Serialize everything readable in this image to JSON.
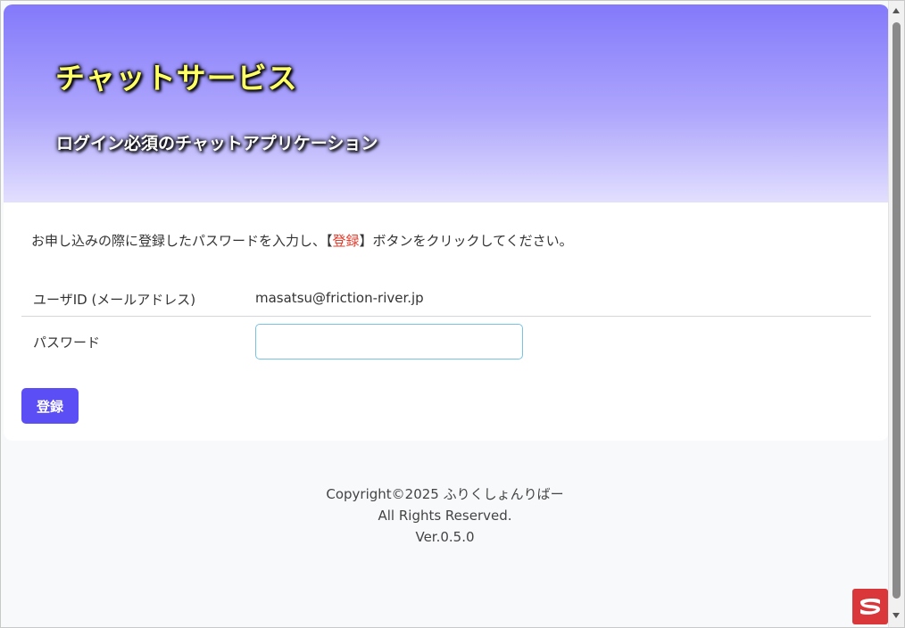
{
  "header": {
    "title": "チャットサービス",
    "subtitle": "ログイン必須のチャットアプリケーション"
  },
  "instruction": {
    "before": "お申し込みの際に登録したパスワードを入力し、【",
    "highlight": "登録",
    "after": "】ボタンをクリックしてください。"
  },
  "form": {
    "userid_label": "ユーザID (メールアドレス)",
    "userid_value": "masatsu@friction-river.jp",
    "password_label": "パスワード",
    "password_value": "",
    "submit_label": "登録"
  },
  "footer": {
    "copyright": "Copyright©2025 ふりくしょんりばー",
    "rights": "All Rights Reserved.",
    "version": "Ver.0.5.0"
  },
  "colors": {
    "header_top": "#8379fb",
    "button": "#5b4ef5",
    "highlight": "#e63a2a"
  }
}
